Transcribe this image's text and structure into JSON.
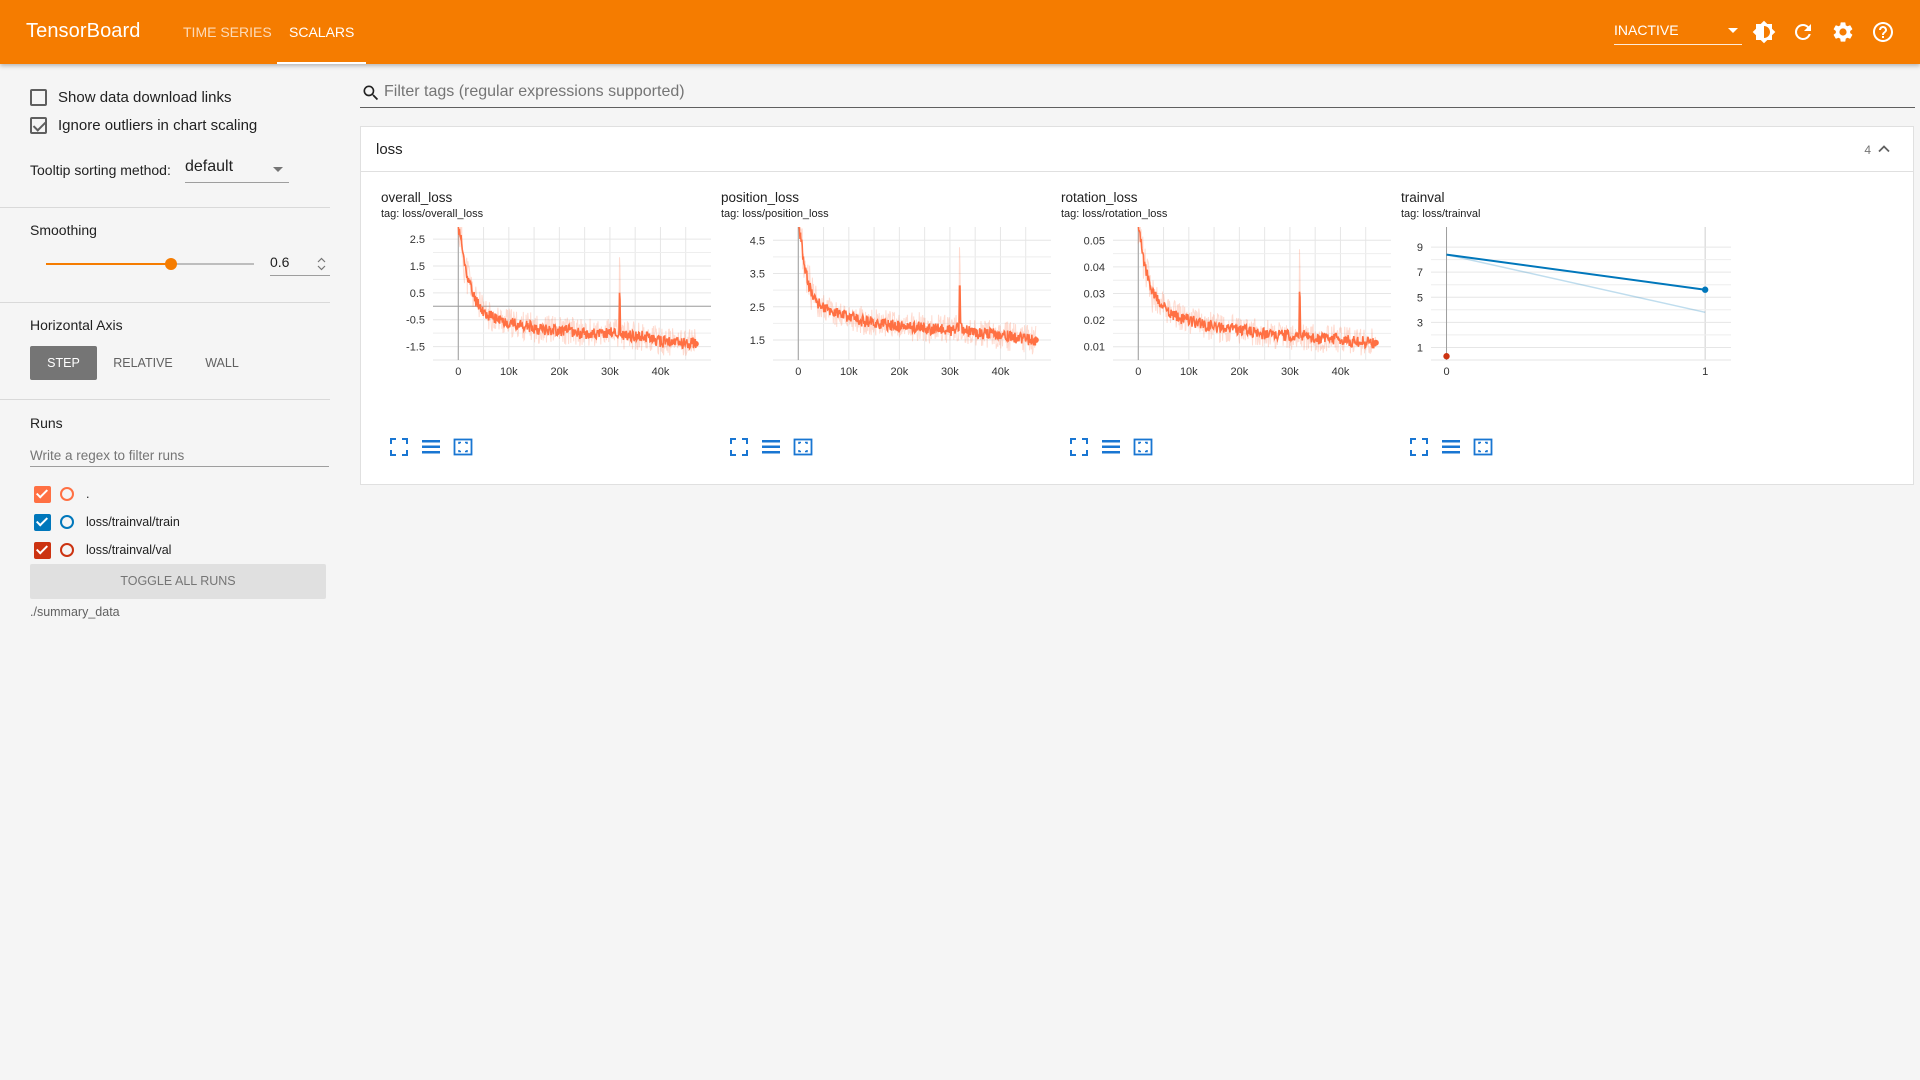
{
  "header": {
    "brand": "TensorBoard",
    "tabs": [
      {
        "label": "TIME SERIES",
        "active": false
      },
      {
        "label": "SCALARS",
        "active": true
      }
    ],
    "reload_status": "INACTIVE",
    "icons": [
      "theme-toggle-icon",
      "reload-icon",
      "settings-icon",
      "help-icon"
    ]
  },
  "sidebar": {
    "show_download_label": "Show data download links",
    "show_download_checked": false,
    "ignore_outliers_label": "Ignore outliers in chart scaling",
    "ignore_outliers_checked": true,
    "tooltip_label": "Tooltip sorting method:",
    "tooltip_value": "default",
    "smoothing_label": "Smoothing",
    "smoothing_value": "0.6",
    "smoothing_fraction": 0.6,
    "axis_label": "Horizontal Axis",
    "axis_options": [
      "STEP",
      "RELATIVE",
      "WALL"
    ],
    "axis_selected": "STEP",
    "runs_label": "Runs",
    "runs_filter_placeholder": "Write a regex to filter runs",
    "runs": [
      {
        "name": ".",
        "color": "#ff7043",
        "checked": true
      },
      {
        "name": "loss/trainval/train",
        "color": "#0077bb",
        "checked": true
      },
      {
        "name": "loss/trainval/val",
        "color": "#cc3311",
        "checked": true
      }
    ],
    "toggle_all_label": "TOGGLE ALL RUNS",
    "log_dir": "./summary_data"
  },
  "main": {
    "filter_placeholder": "Filter tags (regular expressions supported)",
    "group": {
      "name": "loss",
      "count": "4"
    }
  },
  "colors": {
    "accent": "#f57c00",
    "series_main": "#ff7043",
    "series_train": "#0077bb",
    "series_val": "#cc3311"
  },
  "chart_data": [
    {
      "type": "line",
      "title": "overall_loss",
      "tag": "tag: loss/overall_loss",
      "xticks": [
        "0",
        "10k",
        "20k",
        "30k",
        "40k"
      ],
      "yticks": [
        "2.5",
        "1.5",
        "0.5",
        "-0.5",
        "-1.5"
      ],
      "xlim": [
        -5000,
        50000
      ],
      "ylim": [
        -2.0,
        2.95
      ],
      "series": [
        {
          "color": "#ff7043",
          "x": [
            0,
            500,
            1000,
            2000,
            3000,
            4000,
            5000,
            6000,
            8000,
            10000,
            12000,
            14000,
            16000,
            18000,
            20000,
            22000,
            24000,
            26000,
            28000,
            30000,
            32000,
            34000,
            36000,
            38000,
            40000,
            42000,
            44000,
            46000,
            47000
          ],
          "y": [
            2.9,
            2.6,
            1.8,
            1.0,
            0.4,
            0.1,
            -0.2,
            -0.35,
            -0.5,
            -0.6,
            -0.7,
            -0.75,
            -0.85,
            -0.85,
            -0.9,
            -0.9,
            -1.0,
            -1.0,
            -1.05,
            -0.95,
            -1.05,
            -1.1,
            -1.1,
            -1.2,
            -1.3,
            -1.35,
            -1.35,
            -1.35,
            -1.4
          ]
        }
      ]
    },
    {
      "type": "line",
      "title": "position_loss",
      "tag": "tag: loss/position_loss",
      "xticks": [
        "0",
        "10k",
        "20k",
        "30k",
        "40k"
      ],
      "yticks": [
        "4.5",
        "3.5",
        "2.5",
        "1.5"
      ],
      "xlim": [
        -5000,
        50000
      ],
      "ylim": [
        0.9,
        4.9
      ],
      "series": [
        {
          "color": "#ff7043",
          "x": [
            0,
            500,
            1000,
            2000,
            3000,
            4000,
            5000,
            6000,
            8000,
            10000,
            12000,
            14000,
            16000,
            18000,
            20000,
            22000,
            24000,
            26000,
            28000,
            30000,
            32000,
            34000,
            36000,
            38000,
            40000,
            42000,
            44000,
            46000,
            47000
          ],
          "y": [
            4.9,
            4.6,
            3.9,
            3.2,
            2.8,
            2.6,
            2.5,
            2.4,
            2.3,
            2.2,
            2.1,
            2.05,
            2.0,
            1.95,
            1.9,
            1.9,
            1.9,
            1.8,
            1.85,
            1.8,
            1.85,
            1.75,
            1.7,
            1.7,
            1.65,
            1.6,
            1.55,
            1.5,
            1.5
          ]
        }
      ]
    },
    {
      "type": "line",
      "title": "rotation_loss",
      "tag": "tag: loss/rotation_loss",
      "xticks": [
        "0",
        "10k",
        "20k",
        "30k",
        "40k"
      ],
      "yticks": [
        "0.05",
        "0.04",
        "0.03",
        "0.02",
        "0.01"
      ],
      "xlim": [
        -5000,
        50000
      ],
      "ylim": [
        0.005,
        0.055
      ],
      "series": [
        {
          "color": "#ff7043",
          "x": [
            0,
            500,
            1000,
            2000,
            3000,
            4000,
            5000,
            6000,
            8000,
            10000,
            12000,
            14000,
            16000,
            18000,
            20000,
            22000,
            24000,
            26000,
            28000,
            30000,
            32000,
            34000,
            36000,
            38000,
            40000,
            42000,
            44000,
            46000,
            47000
          ],
          "y": [
            0.055,
            0.05,
            0.043,
            0.035,
            0.03,
            0.027,
            0.025,
            0.023,
            0.021,
            0.02,
            0.019,
            0.018,
            0.017,
            0.017,
            0.016,
            0.016,
            0.015,
            0.015,
            0.0145,
            0.014,
            0.0145,
            0.0135,
            0.013,
            0.013,
            0.0125,
            0.012,
            0.012,
            0.0115,
            0.0115
          ]
        }
      ]
    },
    {
      "type": "line",
      "title": "trainval",
      "tag": "tag: loss/trainval",
      "xticks": [
        "0",
        "1"
      ],
      "yticks": [
        "9",
        "7",
        "5",
        "3",
        "1"
      ],
      "xlim": [
        -0.06,
        1.1
      ],
      "ylim": [
        0.0,
        10.6
      ],
      "series": [
        {
          "name": "loss/trainval/train",
          "color": "#0077bb",
          "x": [
            0,
            1
          ],
          "y": [
            8.4,
            5.6
          ]
        },
        {
          "name": "loss/trainval/val",
          "color": "#cc3311",
          "x": [
            0
          ],
          "y": [
            0.3
          ]
        }
      ]
    }
  ]
}
